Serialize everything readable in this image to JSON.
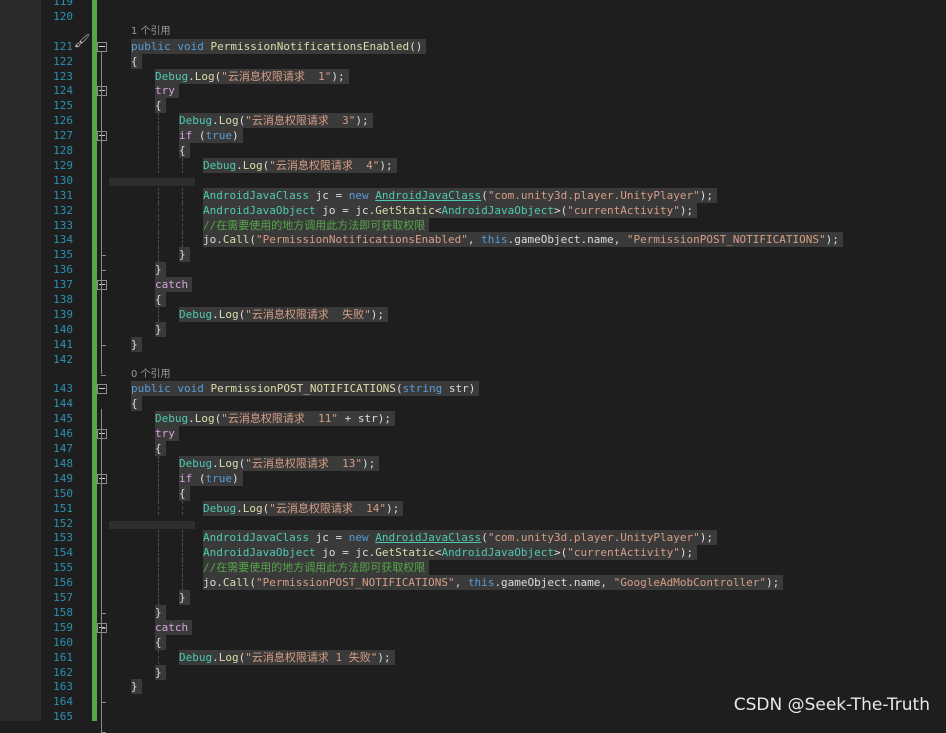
{
  "editor": {
    "watermark": "CSDN @Seek-The-Truth",
    "colors": {
      "background": "#1e1e1e",
      "line_number": "#2b91af",
      "keyword": "#569cd6",
      "type": "#4ec9b0",
      "method": "#dcdcaa",
      "string": "#d69d85",
      "comment": "#57a64a",
      "control": "#d8a0df",
      "change_bar": "#57a64a"
    },
    "margin_icon": "brush-icon",
    "lines": [
      {
        "n": "119",
        "indent": 0,
        "t": []
      },
      {
        "n": "120",
        "indent": 0,
        "t": []
      },
      {
        "n": "",
        "lens": "1 个引用",
        "indent": 1,
        "t": []
      },
      {
        "n": "121",
        "indent": 1,
        "fold": "open",
        "t": [
          [
            "kw",
            "public"
          ],
          [
            "pl",
            " "
          ],
          [
            "kw",
            "void"
          ],
          [
            "pl",
            " "
          ],
          [
            "me",
            "PermissionNotificationsEnabled"
          ],
          [
            "pl",
            "()"
          ]
        ]
      },
      {
        "n": "122",
        "indent": 1,
        "t": [
          [
            "pl",
            "{"
          ]
        ]
      },
      {
        "n": "123",
        "indent": 2,
        "t": [
          [
            "ty",
            "Debug"
          ],
          [
            "pl",
            "."
          ],
          [
            "me",
            "Log"
          ],
          [
            "pl",
            "("
          ],
          [
            "st",
            "\"云消息权限请求  1\""
          ],
          [
            "pl",
            ");"
          ]
        ]
      },
      {
        "n": "124",
        "indent": 2,
        "fold": "open",
        "t": [
          [
            "cf",
            "try"
          ]
        ]
      },
      {
        "n": "125",
        "indent": 2,
        "t": [
          [
            "pl",
            "{"
          ]
        ]
      },
      {
        "n": "126",
        "indent": 3,
        "t": [
          [
            "ty",
            "Debug"
          ],
          [
            "pl",
            "."
          ],
          [
            "me",
            "Log"
          ],
          [
            "pl",
            "("
          ],
          [
            "st",
            "\"云消息权限请求  3\""
          ],
          [
            "pl",
            ");"
          ]
        ]
      },
      {
        "n": "127",
        "indent": 3,
        "fold": "open",
        "t": [
          [
            "cf",
            "if"
          ],
          [
            "pl",
            " ("
          ],
          [
            "kw",
            "true"
          ],
          [
            "pl",
            ")"
          ]
        ]
      },
      {
        "n": "128",
        "indent": 3,
        "t": [
          [
            "pl",
            "{"
          ]
        ]
      },
      {
        "n": "129",
        "indent": 4,
        "t": [
          [
            "ty",
            "Debug"
          ],
          [
            "pl",
            "."
          ],
          [
            "me",
            "Log"
          ],
          [
            "pl",
            "("
          ],
          [
            "st",
            "\"云消息权限请求  4\""
          ],
          [
            "pl",
            ");"
          ]
        ]
      },
      {
        "n": "130",
        "indent": 0,
        "band": true,
        "t": []
      },
      {
        "n": "131",
        "indent": 4,
        "t": [
          [
            "ty",
            "AndroidJavaClass"
          ],
          [
            "pl",
            " jc = "
          ],
          [
            "kw",
            "new"
          ],
          [
            "pl",
            " "
          ],
          [
            "ty",
            "AndroidJavaClass",
            "us"
          ],
          [
            "pl",
            "("
          ],
          [
            "st",
            "\"com.unity3d.player.UnityPlayer\""
          ],
          [
            "pl",
            ");"
          ]
        ]
      },
      {
        "n": "132",
        "indent": 4,
        "t": [
          [
            "ty",
            "AndroidJavaObject"
          ],
          [
            "pl",
            " jo = jc."
          ],
          [
            "me",
            "GetStatic"
          ],
          [
            "pl",
            "<"
          ],
          [
            "ty",
            "AndroidJavaObject"
          ],
          [
            "pl",
            ">("
          ],
          [
            "st",
            "\"currentActivity\""
          ],
          [
            "pl",
            ");"
          ]
        ]
      },
      {
        "n": "133",
        "indent": 4,
        "t": [
          [
            "cm",
            "//在需要使用的地方调用此方法即可获取权限"
          ]
        ]
      },
      {
        "n": "134",
        "indent": 4,
        "t": [
          [
            "pl",
            "jo."
          ],
          [
            "me",
            "Call"
          ],
          [
            "pl",
            "("
          ],
          [
            "st",
            "\"PermissionNotificationsEnabled\""
          ],
          [
            "pl",
            ", "
          ],
          [
            "kw",
            "this"
          ],
          [
            "pl",
            ".gameObject.name, "
          ],
          [
            "st",
            "\"PermissionPOST_NOTIFICATIONS\""
          ],
          [
            "pl",
            ");"
          ]
        ]
      },
      {
        "n": "135",
        "indent": 3,
        "t": [
          [
            "pl",
            "}"
          ]
        ]
      },
      {
        "n": "136",
        "indent": 2,
        "t": [
          [
            "pl",
            "}"
          ]
        ]
      },
      {
        "n": "137",
        "indent": 2,
        "fold": "open",
        "t": [
          [
            "cf",
            "catch"
          ]
        ]
      },
      {
        "n": "138",
        "indent": 2,
        "t": [
          [
            "pl",
            "{"
          ]
        ]
      },
      {
        "n": "139",
        "indent": 3,
        "t": [
          [
            "ty",
            "Debug"
          ],
          [
            "pl",
            "."
          ],
          [
            "me",
            "Log"
          ],
          [
            "pl",
            "("
          ],
          [
            "st",
            "\"云消息权限请求  失败\""
          ],
          [
            "pl",
            ");"
          ]
        ]
      },
      {
        "n": "140",
        "indent": 2,
        "t": [
          [
            "pl",
            "}"
          ]
        ]
      },
      {
        "n": "141",
        "indent": 1,
        "t": [
          [
            "pl",
            "}"
          ]
        ]
      },
      {
        "n": "142",
        "indent": 0,
        "t": []
      },
      {
        "n": "",
        "lens": "0 个引用",
        "indent": 1,
        "t": []
      },
      {
        "n": "143",
        "indent": 1,
        "fold": "open",
        "t": [
          [
            "kw",
            "public"
          ],
          [
            "pl",
            " "
          ],
          [
            "kw",
            "void"
          ],
          [
            "pl",
            " "
          ],
          [
            "me",
            "PermissionPOST_NOTIFICATIONS"
          ],
          [
            "pl",
            "("
          ],
          [
            "kw",
            "string"
          ],
          [
            "pl",
            " str)"
          ]
        ]
      },
      {
        "n": "144",
        "indent": 1,
        "t": [
          [
            "pl",
            "{"
          ]
        ]
      },
      {
        "n": "145",
        "indent": 2,
        "t": [
          [
            "ty",
            "Debug"
          ],
          [
            "pl",
            "."
          ],
          [
            "me",
            "Log"
          ],
          [
            "pl",
            "("
          ],
          [
            "st",
            "\"云消息权限请求  11\""
          ],
          [
            "pl",
            " + str);"
          ]
        ]
      },
      {
        "n": "146",
        "indent": 2,
        "fold": "open",
        "t": [
          [
            "cf",
            "try"
          ]
        ]
      },
      {
        "n": "147",
        "indent": 2,
        "t": [
          [
            "pl",
            "{"
          ]
        ]
      },
      {
        "n": "148",
        "indent": 3,
        "t": [
          [
            "ty",
            "Debug"
          ],
          [
            "pl",
            "."
          ],
          [
            "me",
            "Log"
          ],
          [
            "pl",
            "("
          ],
          [
            "st",
            "\"云消息权限请求  13\""
          ],
          [
            "pl",
            ");"
          ]
        ]
      },
      {
        "n": "149",
        "indent": 3,
        "fold": "open",
        "t": [
          [
            "cf",
            "if"
          ],
          [
            "pl",
            " ("
          ],
          [
            "kw",
            "true"
          ],
          [
            "pl",
            ")"
          ]
        ]
      },
      {
        "n": "150",
        "indent": 3,
        "t": [
          [
            "pl",
            "{"
          ]
        ]
      },
      {
        "n": "151",
        "indent": 4,
        "t": [
          [
            "ty",
            "Debug"
          ],
          [
            "pl",
            "."
          ],
          [
            "me",
            "Log"
          ],
          [
            "pl",
            "("
          ],
          [
            "st",
            "\"云消息权限请求  14\""
          ],
          [
            "pl",
            ");"
          ]
        ]
      },
      {
        "n": "152",
        "indent": 0,
        "band": true,
        "t": []
      },
      {
        "n": "153",
        "indent": 4,
        "t": [
          [
            "ty",
            "AndroidJavaClass"
          ],
          [
            "pl",
            " jc = "
          ],
          [
            "kw",
            "new"
          ],
          [
            "pl",
            " "
          ],
          [
            "ty",
            "AndroidJavaClass",
            "us"
          ],
          [
            "pl",
            "("
          ],
          [
            "st",
            "\"com.unity3d.player.UnityPlayer\""
          ],
          [
            "pl",
            ");"
          ]
        ]
      },
      {
        "n": "154",
        "indent": 4,
        "t": [
          [
            "ty",
            "AndroidJavaObject"
          ],
          [
            "pl",
            " jo = jc."
          ],
          [
            "me",
            "GetStatic"
          ],
          [
            "pl",
            "<"
          ],
          [
            "ty",
            "AndroidJavaObject"
          ],
          [
            "pl",
            ">("
          ],
          [
            "st",
            "\"currentActivity\""
          ],
          [
            "pl",
            ");"
          ]
        ]
      },
      {
        "n": "155",
        "indent": 4,
        "t": [
          [
            "cm",
            "//在需要使用的地方调用此方法即可获取权限"
          ]
        ]
      },
      {
        "n": "156",
        "indent": 4,
        "t": [
          [
            "pl",
            "jo."
          ],
          [
            "me",
            "Call"
          ],
          [
            "pl",
            "("
          ],
          [
            "st",
            "\"PermissionPOST_NOTIFICATIONS\""
          ],
          [
            "pl",
            ", "
          ],
          [
            "kw",
            "this"
          ],
          [
            "pl",
            ".gameObject.name, "
          ],
          [
            "st",
            "\"GoogleAdMobController\""
          ],
          [
            "pl",
            ");"
          ]
        ]
      },
      {
        "n": "157",
        "indent": 3,
        "t": [
          [
            "pl",
            "}"
          ]
        ]
      },
      {
        "n": "158",
        "indent": 2,
        "t": [
          [
            "pl",
            "}"
          ]
        ]
      },
      {
        "n": "159",
        "indent": 2,
        "fold": "open",
        "t": [
          [
            "cf",
            "catch"
          ]
        ]
      },
      {
        "n": "160",
        "indent": 2,
        "t": [
          [
            "pl",
            "{"
          ]
        ]
      },
      {
        "n": "161",
        "indent": 3,
        "t": [
          [
            "ty",
            "Debug"
          ],
          [
            "pl",
            "."
          ],
          [
            "me",
            "Log"
          ],
          [
            "pl",
            "("
          ],
          [
            "st",
            "\"云消息权限请求 1 失败\""
          ],
          [
            "pl",
            ");"
          ]
        ]
      },
      {
        "n": "162",
        "indent": 2,
        "t": [
          [
            "pl",
            "}"
          ]
        ]
      },
      {
        "n": "163",
        "indent": 1,
        "t": [
          [
            "pl",
            "}"
          ]
        ]
      },
      {
        "n": "164",
        "indent": 0,
        "t": []
      },
      {
        "n": "165",
        "indent": 0,
        "t": []
      }
    ]
  }
}
